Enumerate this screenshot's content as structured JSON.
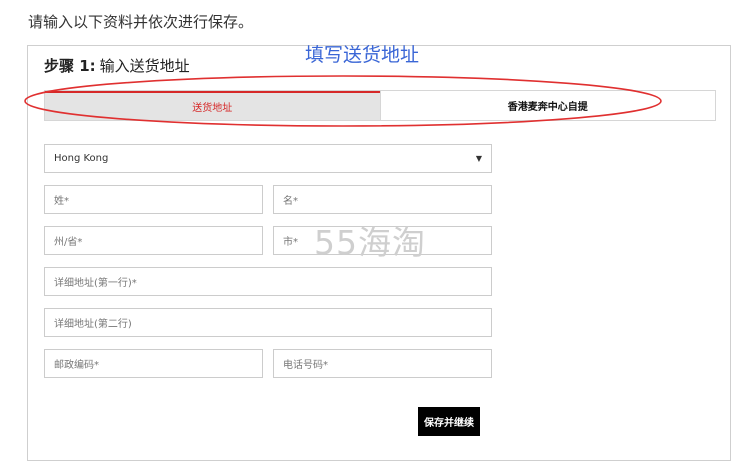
{
  "intro": "请输入以下资料并依次进行保存。",
  "annotation": "填写送货地址",
  "step": {
    "number": "步骤 1:",
    "title": "输入送货地址"
  },
  "tabs": [
    {
      "label": "送货地址",
      "active": true
    },
    {
      "label": "香港麦奔中心自提",
      "active": false
    }
  ],
  "form": {
    "country": {
      "value": "Hong Kong"
    },
    "last_name": {
      "placeholder": "姓*"
    },
    "first_name": {
      "placeholder": "名*"
    },
    "state": {
      "placeholder": "州/省*"
    },
    "city": {
      "placeholder": "市*"
    },
    "address1": {
      "placeholder": "详细地址(第一行)*"
    },
    "address2": {
      "placeholder": "详细地址(第二行)"
    },
    "postcode": {
      "placeholder": "邮政编码*"
    },
    "phone": {
      "placeholder": "电话号码*"
    },
    "submit_label": "保存并继续"
  },
  "watermark": "55海淘",
  "colors": {
    "accent": "#d62828",
    "annotation": "#3a66d6",
    "button": "#000000"
  }
}
